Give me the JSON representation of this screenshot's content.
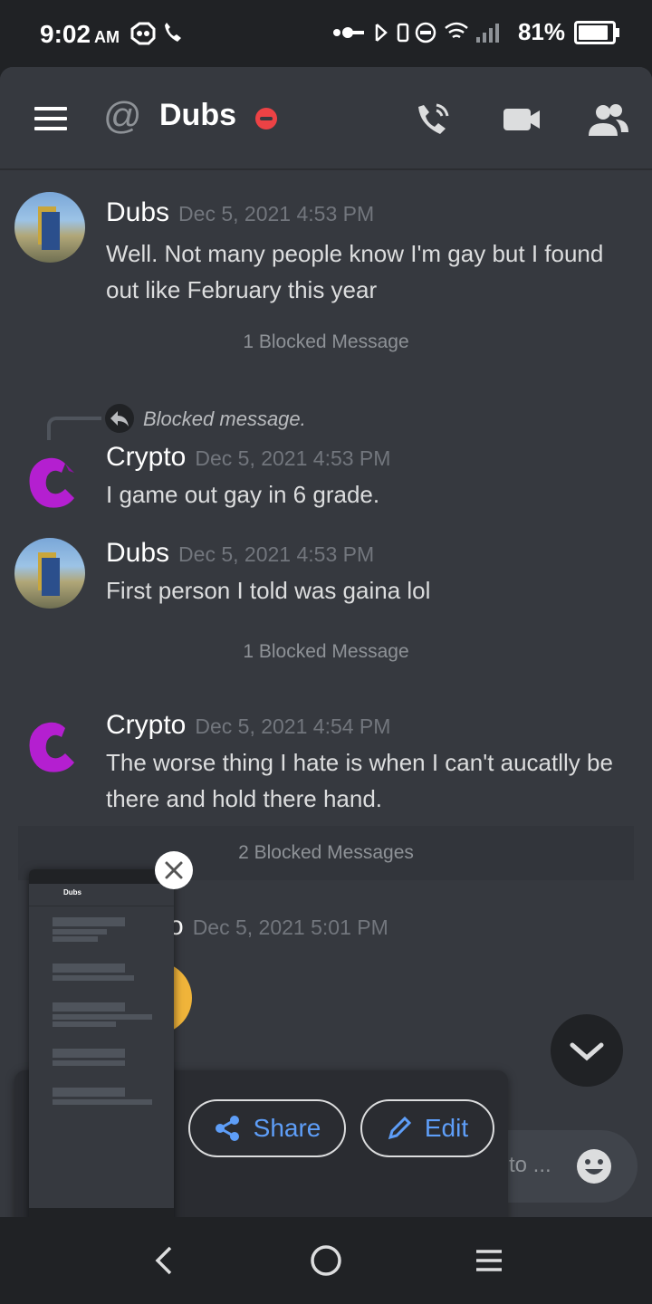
{
  "status_bar": {
    "time": "9:02",
    "ampm": "AM",
    "battery": "81%",
    "battery_level": 0.81
  },
  "header": {
    "channel_name": "Dubs",
    "icons": [
      "menu-icon",
      "at-icon",
      "voice-call-icon",
      "video-call-icon",
      "members-icon"
    ]
  },
  "messages": [
    {
      "author": "Dubs",
      "timestamp": "Dec 5, 2021 4:53 PM",
      "lines": [
        "Well. Not many people know I'm gay but I found",
        "out like February this year"
      ]
    },
    {
      "author": "Crypto",
      "timestamp": "Dec 5, 2021 4:53 PM",
      "reply_to": "Blocked message.",
      "lines": [
        "I game out gay in 6 grade."
      ]
    },
    {
      "author": "Dubs",
      "timestamp": "Dec 5, 2021 4:53 PM",
      "lines": [
        "First person I told was gaina lol"
      ]
    },
    {
      "author": "Crypto",
      "timestamp": "Dec 5, 2021 4:54 PM",
      "lines": [
        "The worse thing I hate is when I can't aucatlly be",
        "there and hold there hand."
      ]
    },
    {
      "author_partial": "o",
      "timestamp": "Dec 5, 2021 5:01 PM"
    }
  ],
  "blocked": {
    "one": "1 Blocked Message",
    "two": "1 Blocked Message",
    "three": "2 Blocked Messages"
  },
  "composer": {
    "placeholder_partial": "to ..."
  },
  "screenshot_actions": {
    "share_label": "Share",
    "edit_label": "Edit"
  },
  "colors": {
    "accent": "#5e9ef8",
    "dnd": "#ed4245",
    "crypto_avatar": "#b41fd0",
    "background": "#36393f"
  }
}
